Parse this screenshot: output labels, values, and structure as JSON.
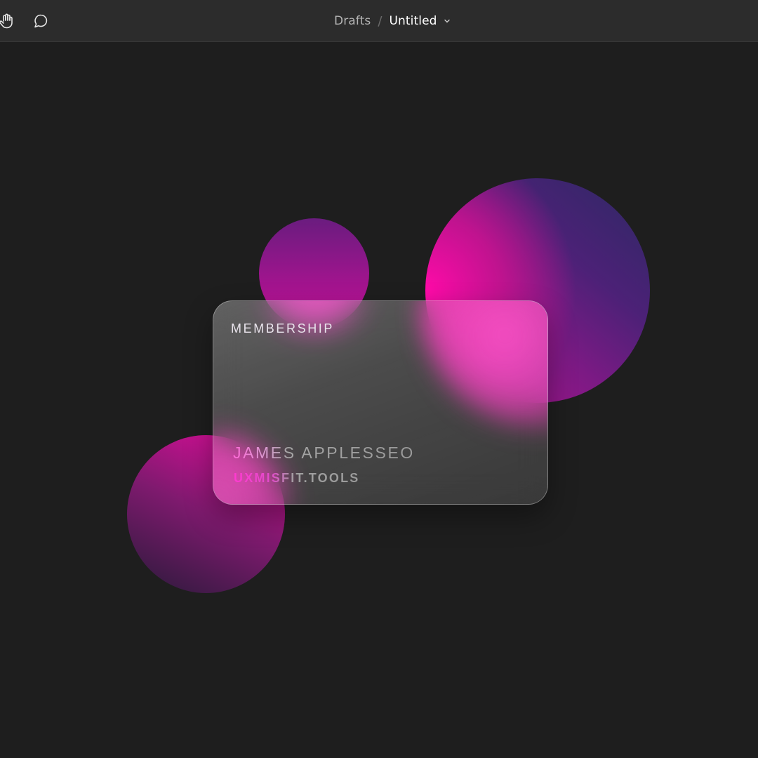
{
  "toolbar": {
    "tools": [
      {
        "name": "hand-tool",
        "icon": "hand-icon"
      },
      {
        "name": "comment-tool",
        "icon": "comment-icon"
      }
    ]
  },
  "breadcrumb": {
    "parent": "Drafts",
    "separator": "/",
    "current": "Untitled",
    "dropdown_icon": "chevron-down-icon"
  },
  "card": {
    "title": "MEMBERSHIP",
    "name": "JAMES APPLESSEO",
    "url": "UXMISFIT.TOOLS"
  },
  "colors": {
    "toolbar_bg": "#2c2c2c",
    "canvas_bg": "#1e1e1e",
    "accent_pink": "#ff0aa8",
    "accent_indigo": "#2d2964"
  }
}
